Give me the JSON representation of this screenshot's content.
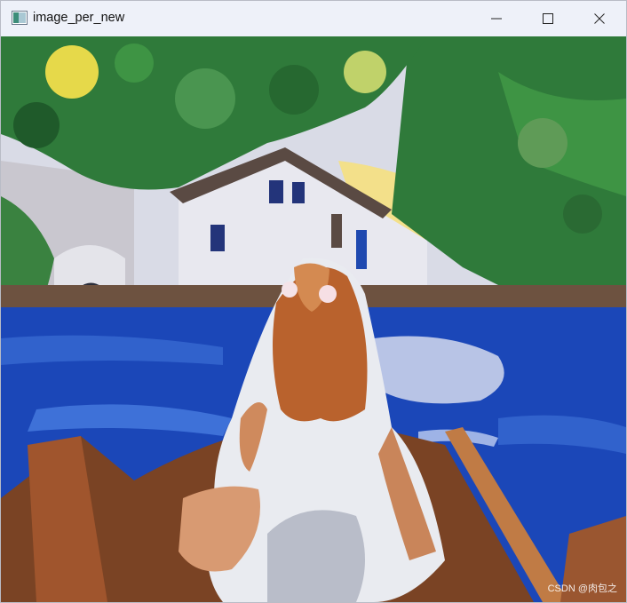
{
  "window": {
    "title": "image_per_new",
    "app_icon": "image-window-icon",
    "buttons": {
      "minimize": "minimize-icon",
      "maximize": "maximize-icon",
      "close": "close-icon"
    }
  },
  "image": {
    "subject": "painted scene",
    "watermark": "CSDN @肉包之"
  },
  "colors": {
    "titlebar": "#eef1f9",
    "water": "#1b47b8",
    "foliage": "#2f7a3a"
  }
}
